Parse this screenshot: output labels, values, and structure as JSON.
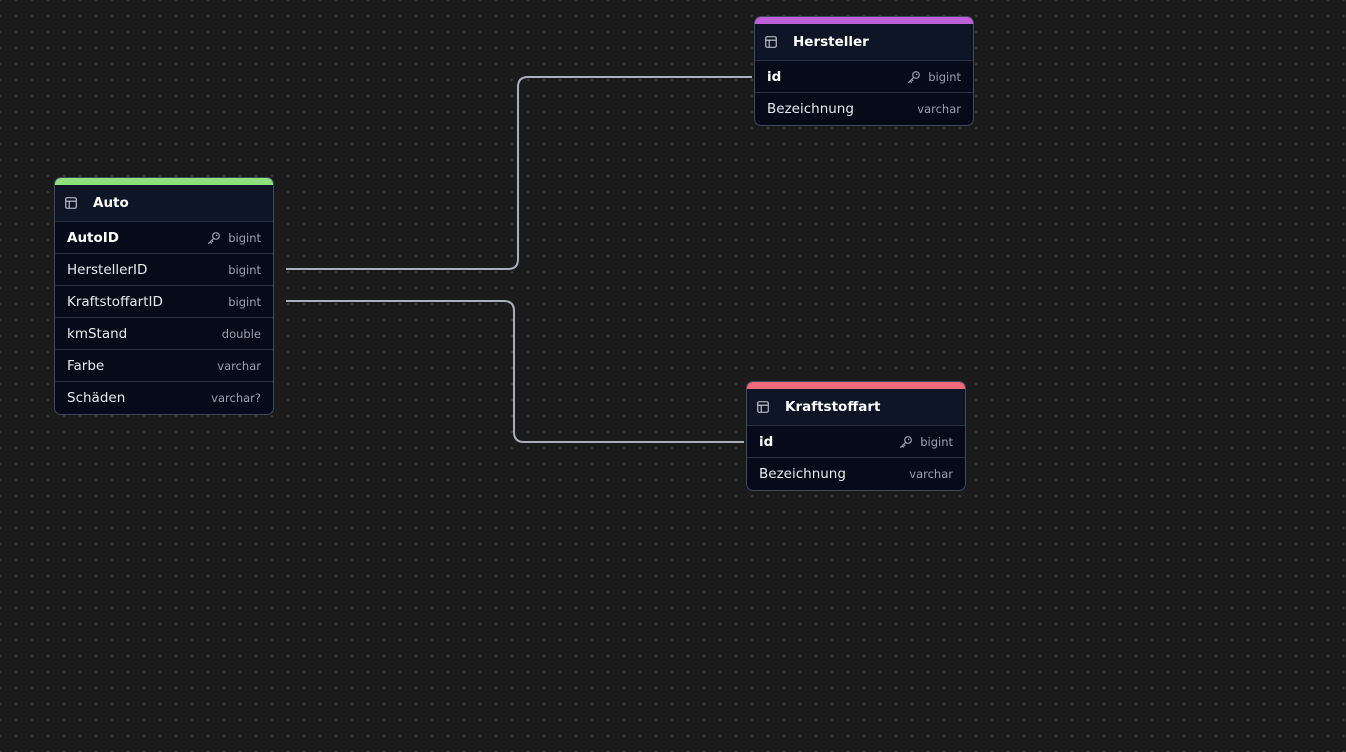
{
  "tables": {
    "auto": {
      "name": "Auto",
      "color": "#8fe07a",
      "fields": [
        {
          "name": "AutoID",
          "type": "bigint",
          "pk": true
        },
        {
          "name": "HerstellerID",
          "type": "bigint"
        },
        {
          "name": "KraftstoffartID",
          "type": "bigint"
        },
        {
          "name": "kmStand",
          "type": "double"
        },
        {
          "name": "Farbe",
          "type": "varchar"
        },
        {
          "name": "Schäden",
          "type": "varchar?"
        }
      ]
    },
    "hersteller": {
      "name": "Hersteller",
      "color": "#c060d8",
      "fields": [
        {
          "name": "id",
          "type": "bigint",
          "pk": true
        },
        {
          "name": "Bezeichnung",
          "type": "varchar"
        }
      ]
    },
    "kraftstoffart": {
      "name": "Kraftstoffart",
      "color": "#f06a7c",
      "fields": [
        {
          "name": "id",
          "type": "bigint",
          "pk": true
        },
        {
          "name": "Bezeichnung",
          "type": "varchar"
        }
      ]
    }
  },
  "relationships": [
    {
      "from": "Auto.HerstellerID",
      "to": "Hersteller.id"
    },
    {
      "from": "Auto.KraftstoffartID",
      "to": "Kraftstoffart.id"
    }
  ]
}
